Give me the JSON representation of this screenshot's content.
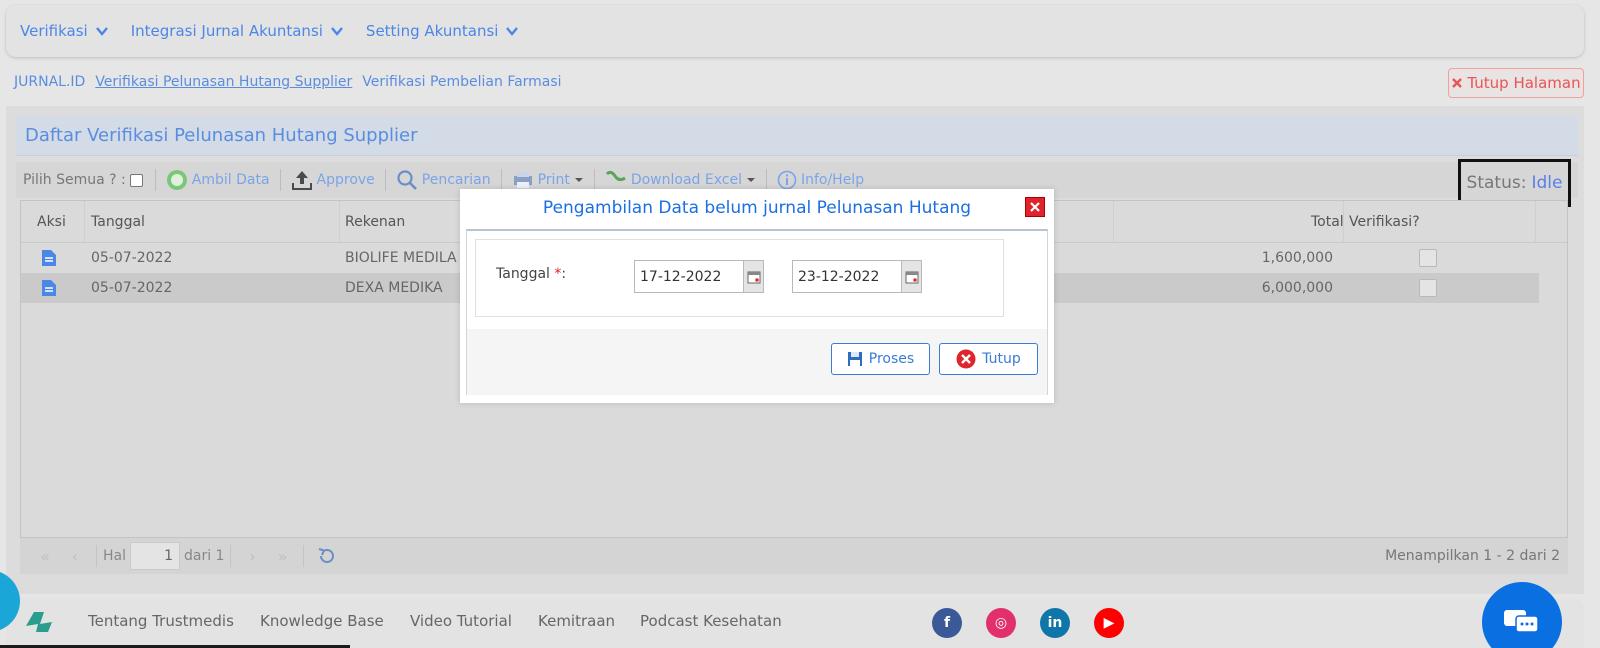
{
  "nav": {
    "menus": [
      {
        "label": "Verifikasi"
      },
      {
        "label": "Integrasi Jurnal Akuntansi"
      },
      {
        "label": "Setting Akuntansi"
      }
    ]
  },
  "tabs": {
    "brand": "JURNAL.ID",
    "active": "Verifikasi Pelunasan Hutang Supplier",
    "other": "Verifikasi Pembelian Farmasi",
    "close_label": "Tutup Halaman"
  },
  "panel": {
    "title": "Daftar Verifikasi Pelunasan Hutang Supplier",
    "toolbar": {
      "select_all": "Pilih Semua ? :",
      "fetch": "Ambil Data",
      "approve": "Approve",
      "search": "Pencarian",
      "print": "Print",
      "download": "Download Excel",
      "info": "Info/Help"
    },
    "status_label": "Status:",
    "status_value": "Idle"
  },
  "grid": {
    "headers": {
      "aksi": "Aksi",
      "tanggal": "Tanggal",
      "rekenan": "Rekenan",
      "total": "Total",
      "verifikasi": "Verifikasi?"
    },
    "rows": [
      {
        "tanggal": "05-07-2022",
        "rekenan": "BIOLIFE MEDILA",
        "total": "1,600,000",
        "verifikasi": false
      },
      {
        "tanggal": "05-07-2022",
        "rekenan": "DEXA MEDIKA",
        "total": "6,000,000",
        "verifikasi": false
      }
    ]
  },
  "pager": {
    "hal_label": "Hal",
    "page": "1",
    "of_label": "dari 1",
    "summary": "Menampilkan 1 - 2 dari 2"
  },
  "modal": {
    "title": "Pengambilan Data belum jurnal Pelunasan Hutang",
    "date_label": "Tanggal",
    "required_mark": "*",
    "date_colon": ":",
    "date_from": "17-12-2022",
    "date_to": "23-12-2022",
    "process_label": "Proses",
    "close_label": "Tutup"
  },
  "footer": {
    "links": [
      "Tentang Trustmedis",
      "Knowledge Base",
      "Video Tutorial",
      "Kemitraan",
      "Podcast Kesehatan"
    ],
    "social": [
      {
        "name": "facebook",
        "color": "#3b5998",
        "glyph": "f"
      },
      {
        "name": "instagram",
        "color": "#e1306c",
        "glyph": "◎"
      },
      {
        "name": "linkedin",
        "color": "#0e76a8",
        "glyph": "in"
      },
      {
        "name": "youtube",
        "color": "#ff0000",
        "glyph": "▶"
      }
    ]
  },
  "colors": {
    "accent": "#3a7bd5",
    "danger": "#e0242b",
    "chat": "#0a6fe0"
  }
}
